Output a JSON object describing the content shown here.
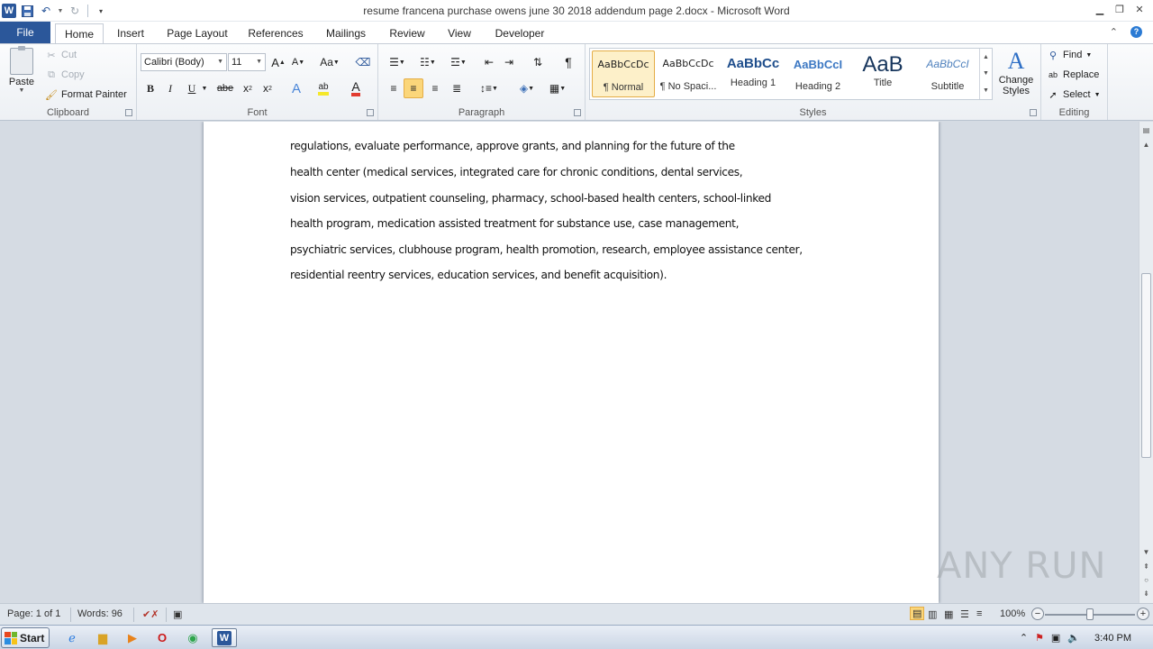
{
  "window": {
    "title": "resume francena purchase owens june 30 2018 addendum page 2.docx - Microsoft Word",
    "app_icon": "W"
  },
  "tabs": [
    "File",
    "Home",
    "Insert",
    "Page Layout",
    "References",
    "Mailings",
    "Review",
    "View",
    "Developer"
  ],
  "active_tab": "Home",
  "ribbon": {
    "clipboard": {
      "label": "Clipboard",
      "paste": "Paste",
      "cut": "Cut",
      "copy": "Copy",
      "format_painter": "Format Painter"
    },
    "font": {
      "label": "Font",
      "font_name": "Calibri (Body)",
      "font_size": "11",
      "grow": "A",
      "shrink": "A",
      "change_case": "Aa",
      "bold": "B",
      "italic": "I",
      "underline": "U",
      "strike": "abe",
      "subscript": "x",
      "superscript": "x",
      "text_effects": "A",
      "highlight": "ab",
      "font_color": "A",
      "highlight_color": "#f5e82b",
      "font_color_value": "#e23b2f"
    },
    "paragraph": {
      "label": "Paragraph",
      "pilcrow": "¶"
    },
    "styles": {
      "label": "Styles",
      "items": [
        {
          "sample": "AaBbCcDc",
          "name": "¶ Normal",
          "selected": true
        },
        {
          "sample": "AaBbCcDc",
          "name": "¶ No Spaci...",
          "selected": false
        },
        {
          "sample": "AaBbCc",
          "name": "Heading 1",
          "selected": false
        },
        {
          "sample": "AaBbCcI",
          "name": "Heading 2",
          "selected": false
        },
        {
          "sample": "AaB",
          "name": "Title",
          "selected": false
        },
        {
          "sample": "AaBbCcI",
          "name": "Subtitle",
          "selected": false
        }
      ],
      "change_styles": [
        "Change",
        "Styles"
      ]
    },
    "editing": {
      "label": "Editing",
      "find": "Find",
      "replace": "Replace",
      "select": "Select"
    }
  },
  "document": {
    "lines": [
      "regulations, evaluate performance, approve grants, and planning for the future of the",
      "health center (medical services, integrated care for chronic conditions, dental services,",
      "vision services, outpatient counseling, pharmacy, school-based health centers, school-linked",
      "health program, medication assisted treatment for substance use, case management,",
      "psychiatric services, clubhouse program, health promotion, research, employee assistance center,",
      "residential reentry services, education services, and benefit acquisition)."
    ]
  },
  "status": {
    "page": "Page: 1 of 1",
    "words": "Words: 96",
    "zoom": "100%"
  },
  "watermark": "ANY RUN",
  "taskbar": {
    "start": "Start",
    "clock": "3:40 PM"
  }
}
